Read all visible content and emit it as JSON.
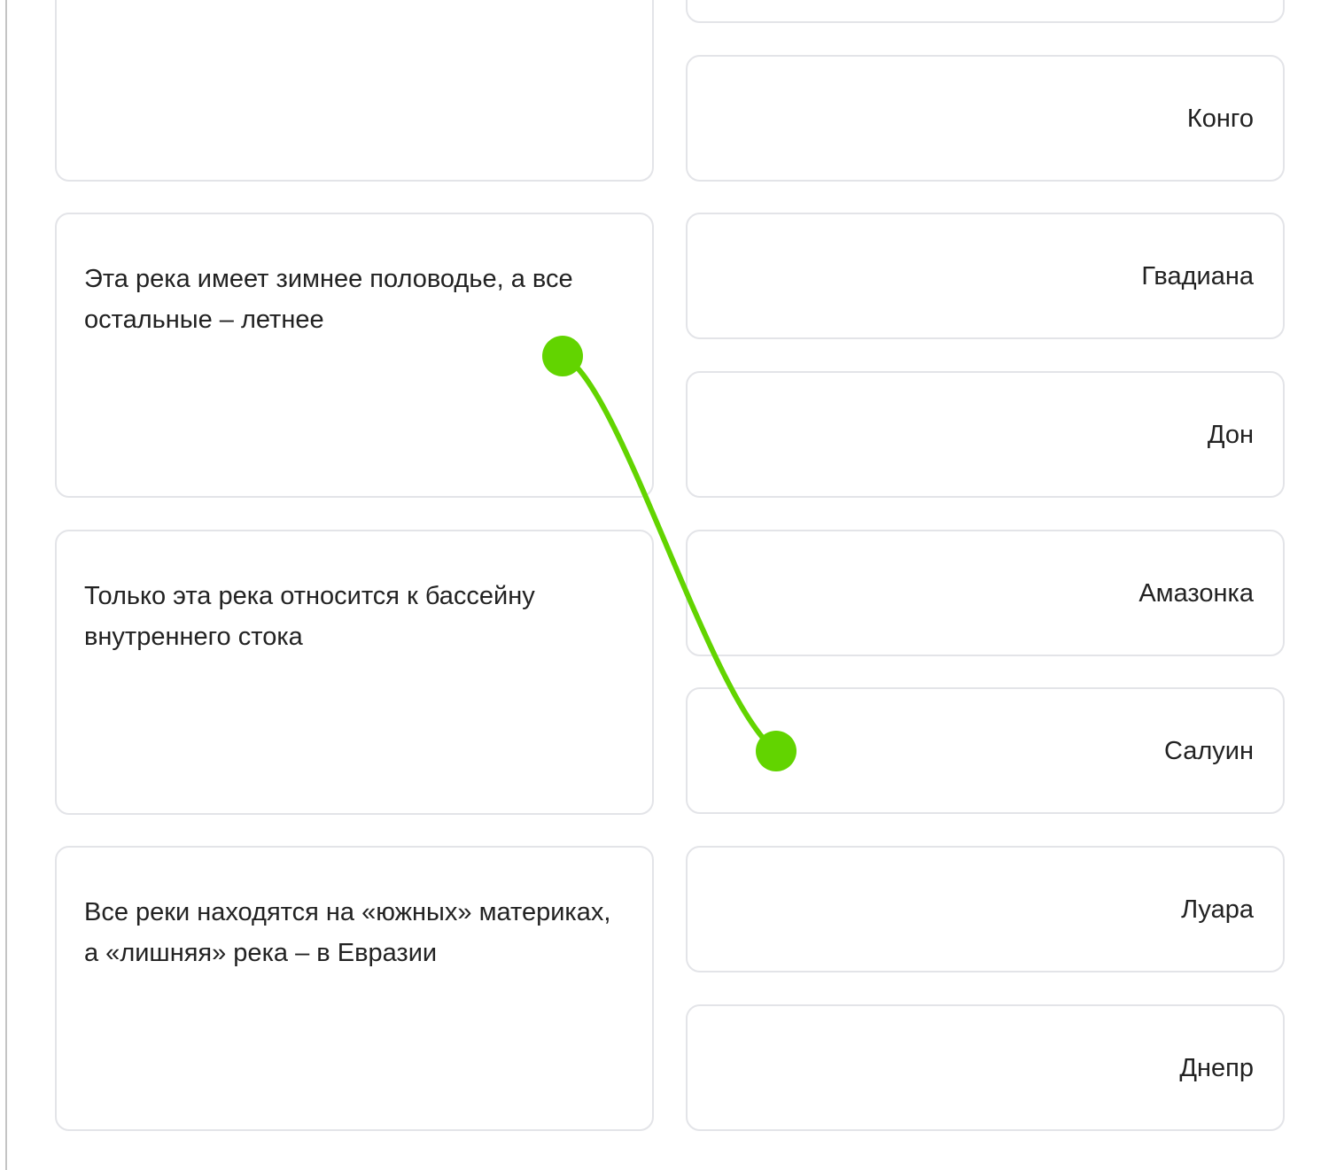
{
  "statements": [
    {
      "text": ""
    },
    {
      "text": "Эта река имеет зимнее половодье, а все остальные – летнее"
    },
    {
      "text": "Только эта река относится к бассейну внутреннего стока"
    },
    {
      "text": "Все реки находятся на «южных» материках, а «лишняя» река – в Евразии"
    }
  ],
  "rivers": [
    {
      "label": ""
    },
    {
      "label": "Конго"
    },
    {
      "label": "Гвадиана"
    },
    {
      "label": "Дон"
    },
    {
      "label": "Амазонка"
    },
    {
      "label": "Салуин"
    },
    {
      "label": "Луара"
    },
    {
      "label": "Днепр"
    }
  ],
  "connection": {
    "from_statement_index": 1,
    "to_river_index": 5,
    "color": "#62d400"
  },
  "colors": {
    "card_border": "#e3e4e8",
    "text": "#222222",
    "connector": "#62d400"
  }
}
